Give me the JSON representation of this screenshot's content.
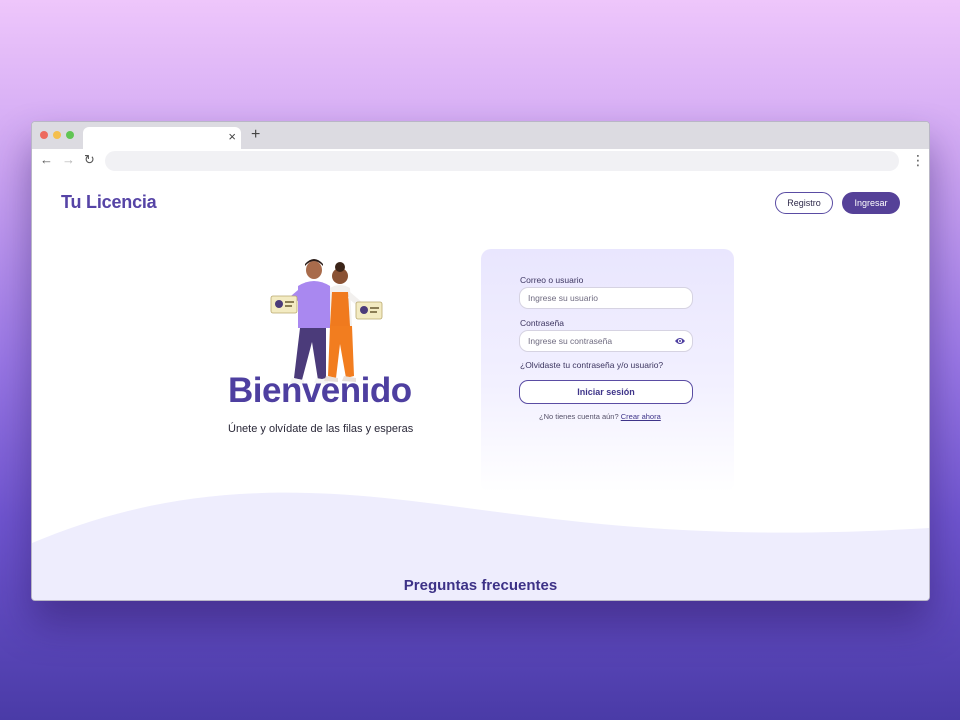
{
  "browser": {
    "address_text": "",
    "tab_title": "",
    "close_glyph": "×",
    "new_tab_glyph": "+",
    "back_glyph": "←",
    "forward_glyph": "→",
    "reload_glyph": "↻",
    "menu_glyph": "⋮"
  },
  "header": {
    "brand": "Tu Licencia",
    "register_label": "Registro",
    "login_label": "Ingresar"
  },
  "hero": {
    "welcome": "Bienvenido",
    "tagline": "Únete y olvídate de las filas y esperas"
  },
  "login": {
    "user_label": "Correo o usuario",
    "user_placeholder": "Ingrese su usuario",
    "password_label": "Contraseña",
    "password_placeholder": "Ingrese su contraseña",
    "forgot": "¿Olvidaste tu contraseña y/o usuario?",
    "submit": "Iniciar sesión",
    "no_account": "¿No tienes cuenta aún?",
    "create_now": "Crear ahora"
  },
  "faq": {
    "title": "Preguntas frecuentes"
  },
  "colors": {
    "brand": "#5644a6",
    "primary_button": "#554198",
    "card_bg": "#e9e6fe",
    "wave": "#eeedfd"
  }
}
